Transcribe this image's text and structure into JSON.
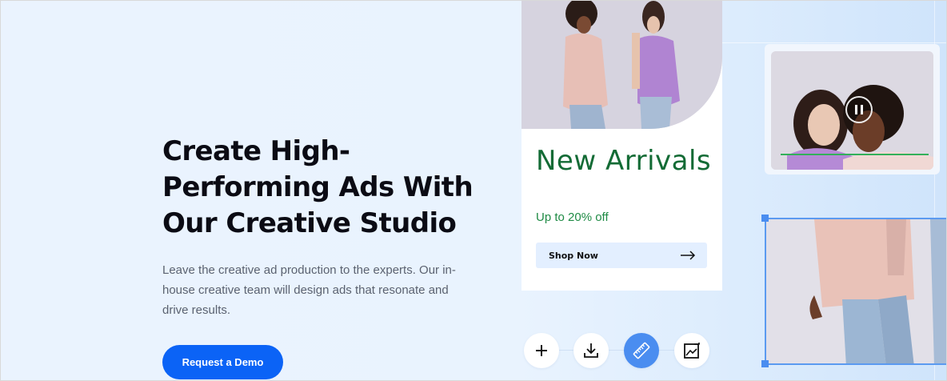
{
  "hero": {
    "headline": "Create High-Performing Ads With Our Creative Studio",
    "description": "Leave the creative ad production to the experts. Our in-house creative team will design ads that resonate and drive results.",
    "cta_label": "Request a Demo"
  },
  "ad_card": {
    "title": "New Arrivals",
    "subtitle": "Up to 20% off",
    "button_label": "Shop Now",
    "title_color": "#136b35"
  },
  "toolbar": {
    "items": [
      {
        "icon": "plus-icon",
        "active": false
      },
      {
        "icon": "download-icon",
        "active": false
      },
      {
        "icon": "ruler-icon",
        "active": true
      },
      {
        "icon": "image-edit-icon",
        "active": false
      }
    ]
  },
  "video_card": {
    "icon": "pause-icon",
    "progress": 0.0
  },
  "colors": {
    "accent": "#0b63f6",
    "selection": "#4a8df0",
    "background": "#eaf3fe"
  }
}
